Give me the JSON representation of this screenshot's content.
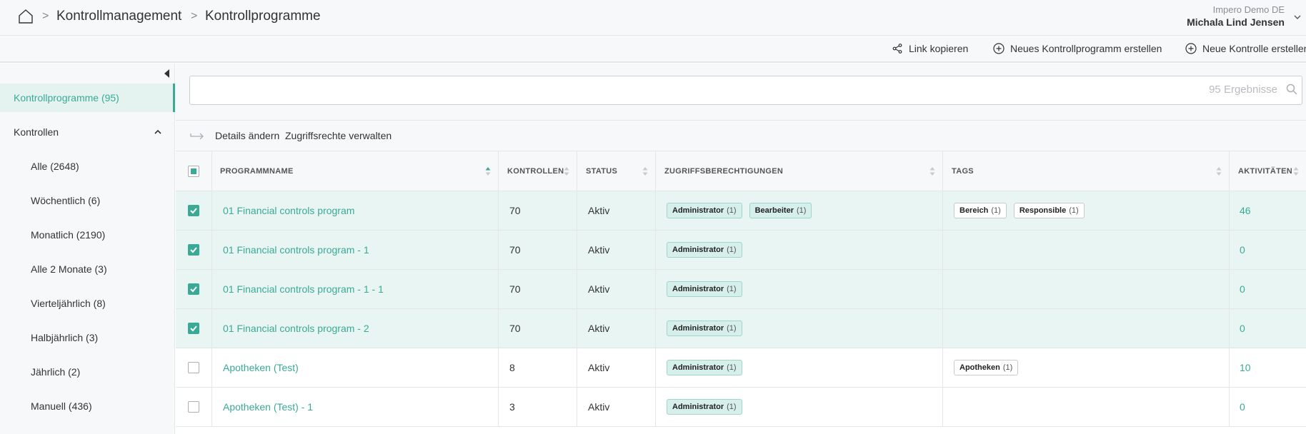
{
  "breadcrumb": {
    "items": [
      "Kontrollmanagement",
      "Kontrollprogramme"
    ]
  },
  "user": {
    "org": "Impero Demo DE",
    "name": "Michala Lind Jensen"
  },
  "actions": {
    "copy_link": "Link kopieren",
    "new_program": "Neues Kontrollprogramm erstellen",
    "new_control": "Neue Kontrolle erstellen"
  },
  "sidebar": {
    "programs": "Kontrollprogramme (95)",
    "controls_header": "Kontrollen",
    "items": [
      "Alle (2648)",
      "Wöchentlich (6)",
      "Monatlich (2190)",
      "Alle 2 Monate (3)",
      "Vierteljährlich (8)",
      "Halbjährlich (3)",
      "Jährlich (2)",
      "Manuell (436)"
    ]
  },
  "search": {
    "placeholder": "",
    "hint": "95 Ergebnisse"
  },
  "toolbar": {
    "edit_details": "Details ändern",
    "manage_access": "Zugriffsrechte verwalten"
  },
  "table": {
    "headers": {
      "name": "Programmname",
      "controls": "Kontrollen",
      "status": "Status",
      "access": "Zugriffsberechtigungen",
      "tags": "Tags",
      "activities": "Aktivitäten"
    },
    "rows": [
      {
        "checked": true,
        "name": "01 Financial controls program",
        "controls": "70",
        "status": "Aktiv",
        "access": [
          {
            "label": "Administrator",
            "count": "(1)"
          },
          {
            "label": "Bearbeiter",
            "count": "(1)"
          }
        ],
        "tags": [
          {
            "label": "Bereich",
            "count": "(1)"
          },
          {
            "label": "Responsible",
            "count": "(1)"
          }
        ],
        "activities": "46"
      },
      {
        "checked": true,
        "name": "01 Financial controls program - 1",
        "controls": "70",
        "status": "Aktiv",
        "access": [
          {
            "label": "Administrator",
            "count": "(1)"
          }
        ],
        "tags": [],
        "activities": "0"
      },
      {
        "checked": true,
        "name": "01 Financial controls program - 1 - 1",
        "controls": "70",
        "status": "Aktiv",
        "access": [
          {
            "label": "Administrator",
            "count": "(1)"
          }
        ],
        "tags": [],
        "activities": "0"
      },
      {
        "checked": true,
        "name": "01 Financial controls program - 2",
        "controls": "70",
        "status": "Aktiv",
        "access": [
          {
            "label": "Administrator",
            "count": "(1)"
          }
        ],
        "tags": [],
        "activities": "0"
      },
      {
        "checked": false,
        "name": "Apotheken (Test)",
        "controls": "8",
        "status": "Aktiv",
        "access": [
          {
            "label": "Administrator",
            "count": "(1)"
          }
        ],
        "tags": [
          {
            "label": "Apotheken",
            "count": "(1)"
          }
        ],
        "activities": "10"
      },
      {
        "checked": false,
        "name": "Apotheken (Test) - 1",
        "controls": "3",
        "status": "Aktiv",
        "access": [
          {
            "label": "Administrator",
            "count": "(1)"
          }
        ],
        "tags": [],
        "activities": "0"
      }
    ]
  },
  "colors": {
    "accent": "#3aaa97",
    "selected_row": "#e8f5f2",
    "panel_bg": "#f7f8f9"
  }
}
